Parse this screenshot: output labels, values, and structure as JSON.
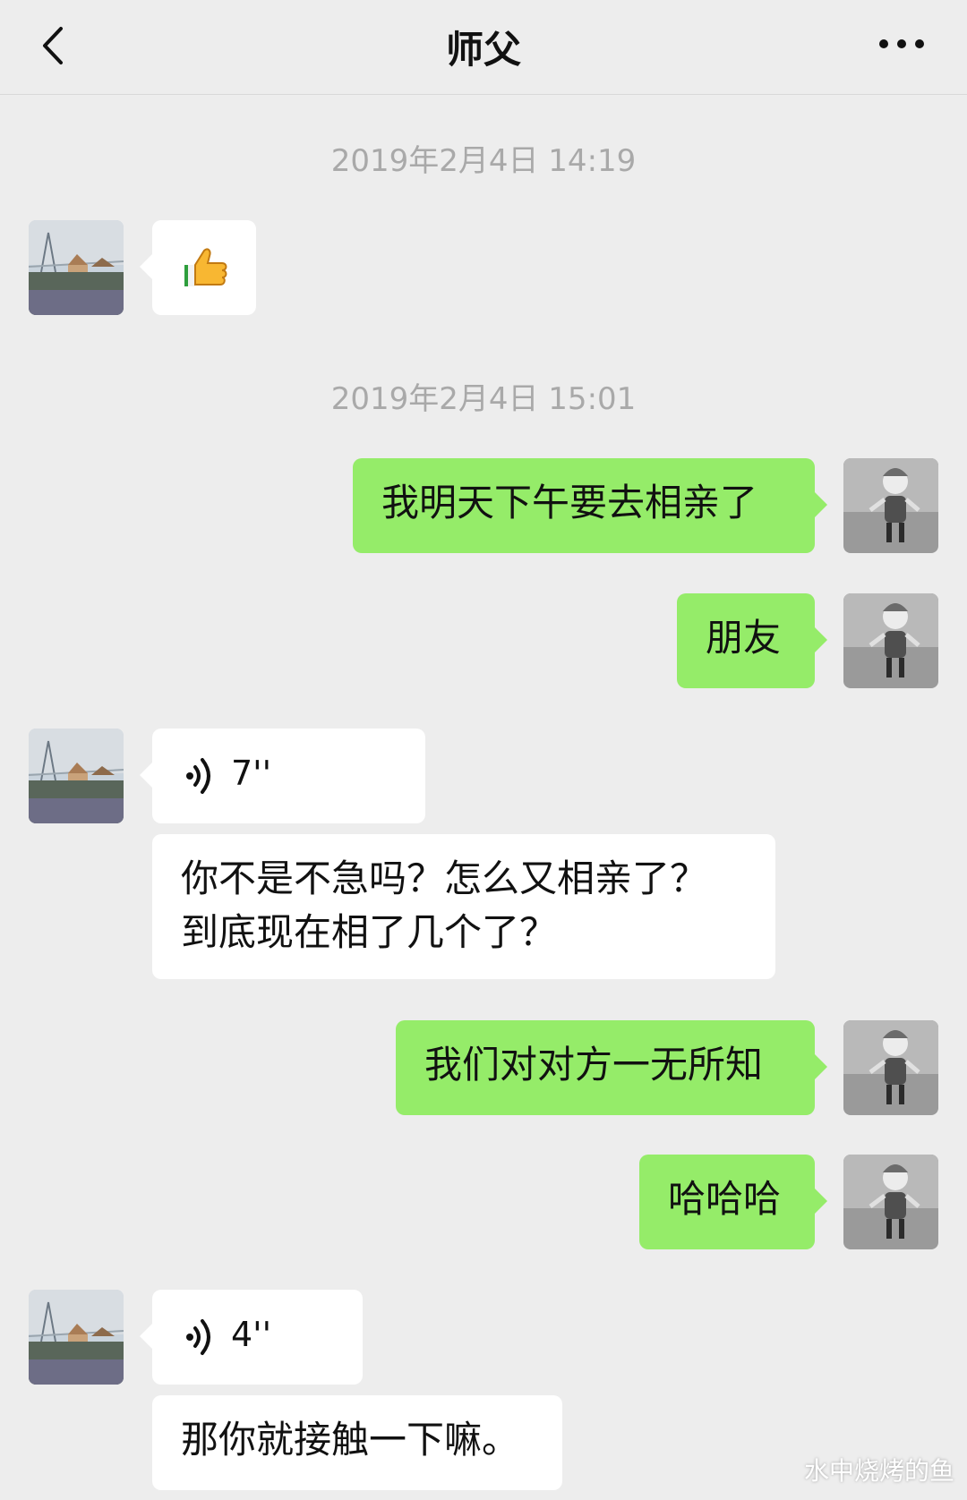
{
  "header": {
    "title": "师父",
    "back_icon": "chevron-left-icon",
    "more_icon": "more-dots-icon"
  },
  "timestamps": [
    "2019年2月4日 14:19",
    "2019年2月4日 15:01"
  ],
  "messages": [
    {
      "from": "contact",
      "type": "emoji",
      "content": "thumbs-up-icon"
    },
    {
      "from": "me",
      "type": "text",
      "content": "我明天下午要去相亲了"
    },
    {
      "from": "me",
      "type": "text",
      "content": "朋友"
    },
    {
      "from": "contact",
      "type": "voice",
      "duration": "7''"
    },
    {
      "from": "contact",
      "type": "text",
      "content": "你不是不急吗？怎么又相亲了？\n到底现在相了几个了？"
    },
    {
      "from": "me",
      "type": "text",
      "content": "我们对对方一无所知"
    },
    {
      "from": "me",
      "type": "text",
      "content": "哈哈哈"
    },
    {
      "from": "contact",
      "type": "voice",
      "duration": "4''"
    },
    {
      "from": "contact",
      "type": "text",
      "content": "那你就接触一下嘛。"
    }
  ],
  "watermark": "水中烧烤的鱼",
  "colors": {
    "background": "#ededed",
    "outgoing_bubble": "#95ec69",
    "incoming_bubble": "#ffffff",
    "timestamp": "#a9a9a9"
  }
}
